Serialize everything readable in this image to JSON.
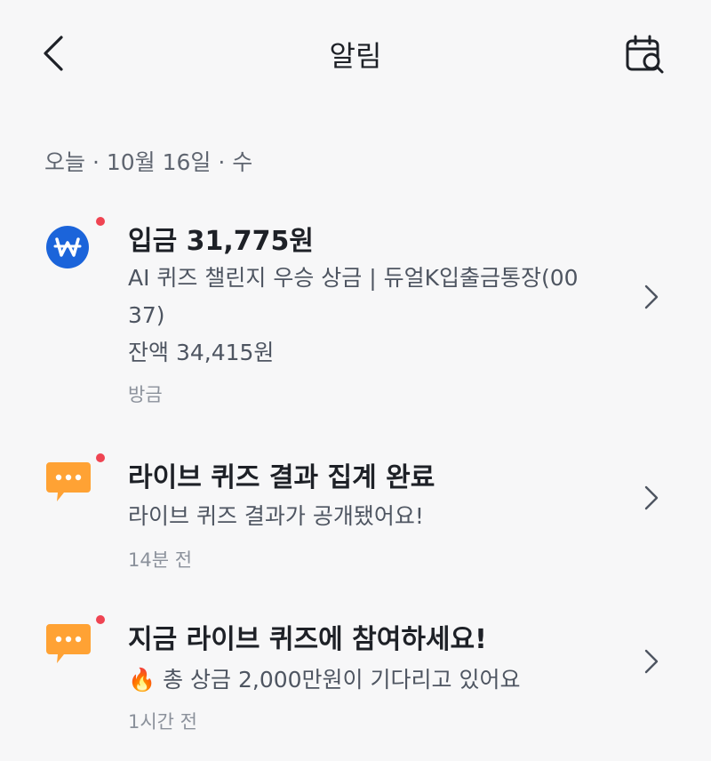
{
  "header": {
    "title": "알림",
    "back_icon": "chevron-left-icon",
    "calendar_icon": "calendar-search-icon"
  },
  "date_header": "오늘 · 10월 16일 · 수",
  "notifications": [
    {
      "icon": "won-coin-icon",
      "icon_color": "#1b64da",
      "unread": true,
      "title": "입금 31,775원",
      "body_line1": "AI 퀴즈 챌린지 우승 상금 | 듀얼K입출금통장(00",
      "body_line2": "37)",
      "body_line3": "잔액 34,415원",
      "meta": "방금"
    },
    {
      "icon": "chat-bubble-icon",
      "icon_color": "#ffa234",
      "unread": true,
      "title": "라이브 퀴즈 결과 집계 완료",
      "body_line1": "라이브 퀴즈 결과가 공개됐어요!",
      "meta": "14분 전"
    },
    {
      "icon": "chat-bubble-icon",
      "icon_color": "#ffa234",
      "unread": true,
      "title": "지금 라이브 퀴즈에 참여하세요!",
      "emoji": "🔥",
      "body_line1": "총 상금 2,000만원이 기다리고 있어요",
      "meta": "1시간 전"
    }
  ],
  "colors": {
    "background": "#f7f7f8",
    "unread_dot": "#ef4452",
    "primary_text": "#1e2127",
    "secondary_text": "#4e5561",
    "meta_text": "#8b919b"
  }
}
